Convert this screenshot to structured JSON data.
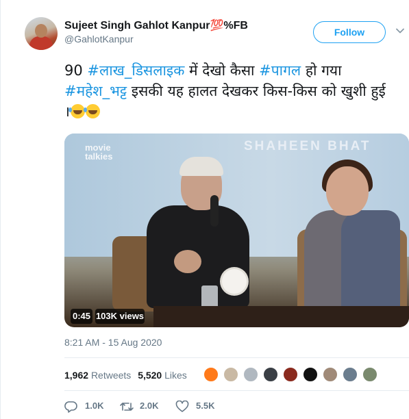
{
  "user": {
    "name": "Sujeet Singh Gahlot Kanpur",
    "name_emoji": "💯",
    "name_suffix": "%FB",
    "handle": "@GahlotKanpur"
  },
  "follow_button": {
    "label": "Follow"
  },
  "tweet": {
    "part1": "90 ",
    "tag1": "#लाख_डिसलाइक",
    "part2": " में देखो कैसा ",
    "tag2": "#पागल",
    "part3": " हो गया ",
    "tag3": "#महेश_भट्ट",
    "part4": " इसकी यह हालत देखकर किस-किस को खुशी हुई ।",
    "emoji": "🤣🤣"
  },
  "media": {
    "banner_text": "SHAHEEN BHAT",
    "logo_line1": "movie",
    "logo_line2": "talkies",
    "duration": "0:45",
    "views": "103K views"
  },
  "timestamp": "8:21 AM - 15 Aug 2020",
  "stats": {
    "retweets_count": "1,962",
    "retweets_label": "Retweets",
    "likes_count": "5,520",
    "likes_label": "Likes"
  },
  "actions": {
    "reply_count": "1.0K",
    "retweet_count": "2.0K",
    "like_count": "5.5K"
  },
  "colors": {
    "link": "#1b95e0",
    "follow": "#1da1f2",
    "secondary_text": "#657786"
  },
  "icons": [
    "caret-down-icon",
    "reply-icon",
    "retweet-icon",
    "like-icon"
  ]
}
